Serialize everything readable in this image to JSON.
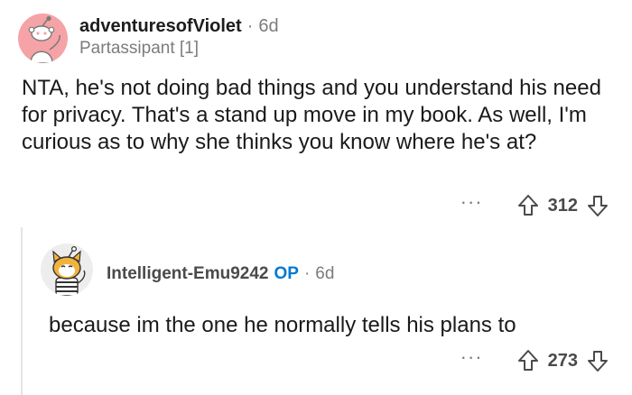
{
  "comment": {
    "author": "adventuresofViolet",
    "separator": "·",
    "age": "6d",
    "flair": "Partassipant [1]",
    "body": "NTA, he's not doing bad things and you understand his need for privacy. That's a stand up move in my book. As well, I'm curious as to why she thinks you know where he's at?",
    "more": "···",
    "score": "312"
  },
  "reply": {
    "author": "Intelligent-Emu9242",
    "op_tag": "OP",
    "separator": "·",
    "age": "6d",
    "body": "because im the one he normally tells his plans to",
    "more": "···",
    "score": "273"
  },
  "icons": {
    "upvote": "upvote-arrow-icon",
    "downvote": "downvote-arrow-icon",
    "more": "more-options-icon",
    "avatar": "snoo-avatar-icon"
  },
  "colors": {
    "avatar_pink": "#f5a3a6",
    "op_blue": "#0079d3",
    "meta_gray": "#7c7c7c"
  }
}
